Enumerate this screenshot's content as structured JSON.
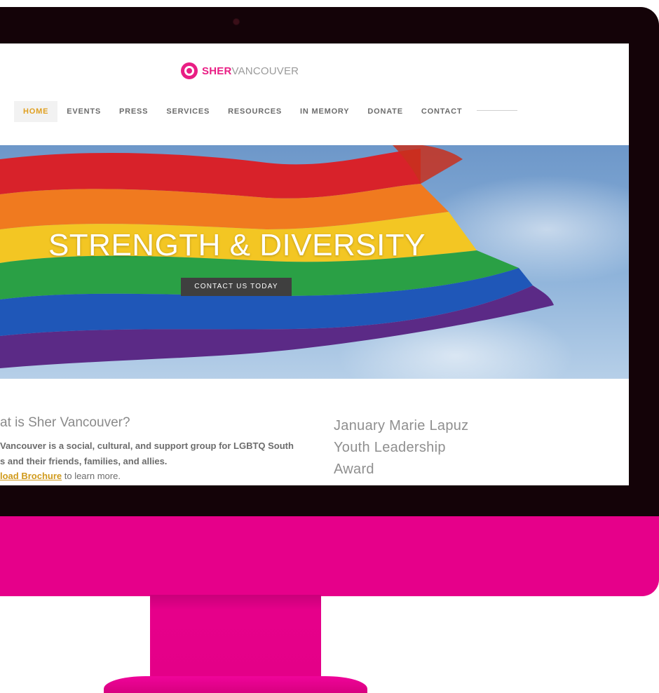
{
  "site": {
    "logo_strong": "SHER",
    "logo_light": "VANCOUVER"
  },
  "nav": {
    "items": [
      {
        "label": "HOME",
        "active": true
      },
      {
        "label": "EVENTS"
      },
      {
        "label": "PRESS"
      },
      {
        "label": "SERVICES"
      },
      {
        "label": "RESOURCES"
      },
      {
        "label": "IN MEMORY"
      },
      {
        "label": "DONATE"
      },
      {
        "label": "CONTACT"
      }
    ]
  },
  "hero": {
    "title": "STRENGTH & DIVERSITY",
    "cta_label": "CONTACT US TODAY"
  },
  "about": {
    "title": "at is Sher Vancouver?",
    "line1": "Vancouver is a social, cultural, and support group for LGBTQ South",
    "line2": "s and their friends, families, and allies.",
    "link_text": "load Brochure",
    "link_suffix": " to learn more."
  },
  "award": {
    "title_line1": "January Marie Lapuz",
    "title_line2": "Youth Leadership",
    "title_line3": "Award"
  },
  "colors": {
    "brand_pink": "#e91e84",
    "stand_pink": "#e6008a",
    "nav_active": "#e0a021",
    "link_gold": "#d09a1c"
  },
  "icons": {
    "logo": "lion-logo-icon",
    "camera": "camera-dot"
  }
}
